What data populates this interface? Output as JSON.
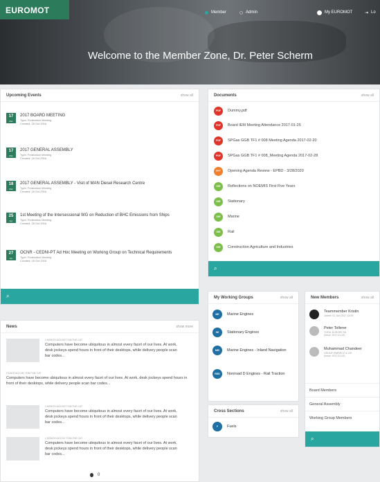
{
  "header": {
    "logo": "EUROMOT",
    "nav_member": "Member",
    "nav_admin": "Admin",
    "nav_my": "My EUROMOT",
    "nav_logout": "Lo",
    "welcome": "Welcome to the Member Zone, Dr. Peter Scherm"
  },
  "events": {
    "title": "Upcoming Events",
    "link": "show all",
    "items": [
      {
        "day": "17",
        "title": "2017 BOARD MEETING",
        "type": "Type: Federation Meeting",
        "created": "Created: 18 Oct 2016"
      },
      {
        "day": "17",
        "title": "2017 GENERAL ASSEMBLY",
        "type": "Type: Federation Meeting",
        "created": "Created: 18 Oct 2016"
      },
      {
        "day": "18",
        "title": "2017 GENERAL ASSEMBLY - Visit of MAN Diesel Research Centre",
        "type": "Type: Federation Meeting",
        "created": "Created: 18 Oct 2016"
      },
      {
        "day": "25",
        "title": "1st Meeting of the Intersessional WG on Reduction of BHC Emissions from Ships",
        "type": "Type: Federation Meeting",
        "created": "Created: 18 Oct 2016"
      },
      {
        "day": "27",
        "title": "OCNR - CEDNI-PT Ad Hoc Meeting on Working Group on Technical Requirements",
        "type": "Type: Federation Meeting",
        "created": "Created: 18 Oct 2016"
      }
    ]
  },
  "documents": {
    "title": "Documents",
    "link": "show all",
    "items": [
      {
        "icon": "PDF",
        "color": "#e0342b",
        "label": "Dummy.pdf"
      },
      {
        "icon": "PDF",
        "color": "#e0342b",
        "label": "Board IEM Meeting Attendance 2017-01-25"
      },
      {
        "icon": "PDF",
        "color": "#e0342b",
        "label": "SPGas GGB TF1 # 008 Meeting Agenda 2017-02-20"
      },
      {
        "icon": "PDF",
        "color": "#e0342b",
        "label": "SPGas GGB TF1 # 008_Meeting Agenda 2017-02-28"
      },
      {
        "icon": "PPT",
        "color": "#f07e2a",
        "label": "Opening Agenda Review - EPBD - 3/28/2020"
      },
      {
        "icon": "DIR",
        "color": "#7bbe4a",
        "label": "Reflections on NOEMIS First Five Years"
      },
      {
        "icon": "DIR",
        "color": "#7bbe4a",
        "label": "Stationary"
      },
      {
        "icon": "DIR",
        "color": "#7bbe4a",
        "label": "Marine"
      },
      {
        "icon": "DIR",
        "color": "#7bbe4a",
        "label": "Rail"
      },
      {
        "icon": "DIR",
        "color": "#7bbe4a",
        "label": "Construction Agriculture and Industries"
      }
    ]
  },
  "working_groups": {
    "title": "My Working Groups",
    "link": "show all",
    "items": [
      {
        "icon": "ME",
        "label": "Marine Engines"
      },
      {
        "icon": "SE",
        "label": "Stationary Engines"
      },
      {
        "icon": "MEI",
        "label": "Marine Engines - Inland Navigation"
      },
      {
        "icon": "RED",
        "label": "Nonroad D Engines - Rail Traction"
      }
    ]
  },
  "cross_sections": {
    "title": "Cross Sections",
    "link": "show all",
    "items": [
      {
        "icon": "F",
        "label": "Fuels"
      }
    ]
  },
  "new_members": {
    "title": "New Members",
    "link": "show all",
    "items": [
      {
        "name": "Teammember Kristin",
        "sub1": "Joined: 01 JAN 2017 13:09",
        "sub2": ""
      },
      {
        "name": "Peter Tollerer",
        "sub1": "TOTAL EUROPE SA",
        "sub2": "(Issue: 2017-01-02)"
      },
      {
        "name": "Muhammad Chandeer",
        "sub1": "GROUP SWIRECO & CIE",
        "sub2": "(Issue: 2017-01-02)"
      }
    ],
    "links": [
      "Board Members",
      "General Assembly",
      "Working Group Members"
    ]
  },
  "news": {
    "title": "News",
    "link": "show more",
    "items": [
      {
        "meta": "1 MONTH AGO BY TOM THE CAT",
        "text": "Computers have become ubiquitous in almost every facet of our lives. At work, desk jockeys spend hours in front of their desktops, while delivery people scan bar codes..."
      },
      {
        "meta": "2 DAYS AGO BY TOM THE CAT",
        "text": "Computers have become ubiquitous in almost every facet of our lives. At work, desk jockeys spend hours in front of their desktops, while delivery people scan bar codes..."
      },
      {
        "meta": "1 MONTH AGO BY TOM THE CAT",
        "text": "Computers have become ubiquitous in almost every facet of our lives. At work, desk jockeys spend hours in front of their desktops, while delivery people scan bar codes..."
      },
      {
        "meta": "1 MONTH AGO BY TOM THE CAT",
        "text": "Computers have become ubiquitous in almost every facet of our lives. At work, desk jockeys spend hours in front of their desktops, while delivery people scan bar codes..."
      }
    ],
    "page": "0"
  },
  "search_icon": "magnifier-icon"
}
